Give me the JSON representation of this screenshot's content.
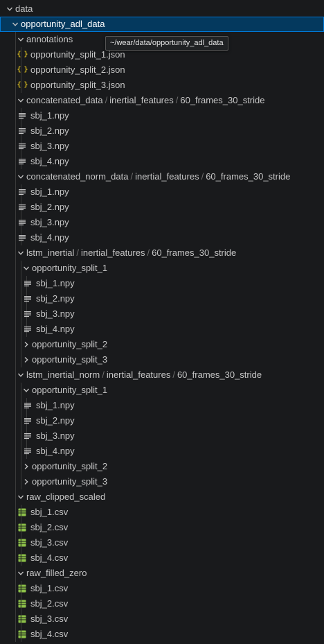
{
  "tooltip": "~/wear/data/opportunity_adl_data",
  "tree": [
    {
      "depth": 0,
      "type": "folder",
      "expanded": true,
      "label": "data"
    },
    {
      "depth": 1,
      "type": "folder",
      "expanded": true,
      "label": "opportunity_adl_data",
      "selected": true
    },
    {
      "depth": 2,
      "type": "folder",
      "expanded": true,
      "label": "annotations"
    },
    {
      "depth": 3,
      "type": "json",
      "label": "opportunity_split_1.json"
    },
    {
      "depth": 3,
      "type": "json",
      "label": "opportunity_split_2.json"
    },
    {
      "depth": 3,
      "type": "json",
      "label": "opportunity_split_3.json"
    },
    {
      "depth": 2,
      "type": "folder",
      "expanded": true,
      "label": [
        "concatenated_data",
        "inertial_features",
        "60_frames_30_stride"
      ]
    },
    {
      "depth": 3,
      "type": "npy",
      "label": "sbj_1.npy"
    },
    {
      "depth": 3,
      "type": "npy",
      "label": "sbj_2.npy"
    },
    {
      "depth": 3,
      "type": "npy",
      "label": "sbj_3.npy"
    },
    {
      "depth": 3,
      "type": "npy",
      "label": "sbj_4.npy"
    },
    {
      "depth": 2,
      "type": "folder",
      "expanded": true,
      "label": [
        "concatenated_norm_data",
        "inertial_features",
        "60_frames_30_stride"
      ]
    },
    {
      "depth": 3,
      "type": "npy",
      "label": "sbj_1.npy"
    },
    {
      "depth": 3,
      "type": "npy",
      "label": "sbj_2.npy"
    },
    {
      "depth": 3,
      "type": "npy",
      "label": "sbj_3.npy"
    },
    {
      "depth": 3,
      "type": "npy",
      "label": "sbj_4.npy"
    },
    {
      "depth": 2,
      "type": "folder",
      "expanded": true,
      "label": [
        "lstm_inertial",
        "inertial_features",
        "60_frames_30_stride"
      ]
    },
    {
      "depth": 3,
      "type": "folder",
      "expanded": true,
      "label": "opportunity_split_1"
    },
    {
      "depth": 4,
      "type": "npy",
      "label": "sbj_1.npy"
    },
    {
      "depth": 4,
      "type": "npy",
      "label": "sbj_2.npy"
    },
    {
      "depth": 4,
      "type": "npy",
      "label": "sbj_3.npy"
    },
    {
      "depth": 4,
      "type": "npy",
      "label": "sbj_4.npy"
    },
    {
      "depth": 3,
      "type": "folder",
      "expanded": false,
      "label": "opportunity_split_2"
    },
    {
      "depth": 3,
      "type": "folder",
      "expanded": false,
      "label": "opportunity_split_3"
    },
    {
      "depth": 2,
      "type": "folder",
      "expanded": true,
      "label": [
        "lstm_inertial_norm",
        "inertial_features",
        "60_frames_30_stride"
      ]
    },
    {
      "depth": 3,
      "type": "folder",
      "expanded": true,
      "label": "opportunity_split_1"
    },
    {
      "depth": 4,
      "type": "npy",
      "label": "sbj_1.npy"
    },
    {
      "depth": 4,
      "type": "npy",
      "label": "sbj_2.npy"
    },
    {
      "depth": 4,
      "type": "npy",
      "label": "sbj_3.npy"
    },
    {
      "depth": 4,
      "type": "npy",
      "label": "sbj_4.npy"
    },
    {
      "depth": 3,
      "type": "folder",
      "expanded": false,
      "label": "opportunity_split_2"
    },
    {
      "depth": 3,
      "type": "folder",
      "expanded": false,
      "label": "opportunity_split_3"
    },
    {
      "depth": 2,
      "type": "folder",
      "expanded": true,
      "label": "raw_clipped_scaled"
    },
    {
      "depth": 3,
      "type": "csv",
      "label": "sbj_1.csv"
    },
    {
      "depth": 3,
      "type": "csv",
      "label": "sbj_2.csv"
    },
    {
      "depth": 3,
      "type": "csv",
      "label": "sbj_3.csv"
    },
    {
      "depth": 3,
      "type": "csv",
      "label": "sbj_4.csv"
    },
    {
      "depth": 2,
      "type": "folder",
      "expanded": true,
      "label": "raw_filled_zero"
    },
    {
      "depth": 3,
      "type": "csv",
      "label": "sbj_1.csv"
    },
    {
      "depth": 3,
      "type": "csv",
      "label": "sbj_2.csv"
    },
    {
      "depth": 3,
      "type": "csv",
      "label": "sbj_3.csv"
    },
    {
      "depth": 3,
      "type": "csv",
      "label": "sbj_4.csv"
    }
  ],
  "colors": {
    "background": "#191a1c",
    "selection": "#04395e",
    "selection_border": "#0078d4",
    "json_icon": "#d7ba1f",
    "csv_icon": "#8dc149",
    "npy_icon": "#c5c5c5"
  },
  "icons": {
    "folder_open": "chevron-down-icon",
    "folder_closed": "chevron-right-icon",
    "json": "json-braces-icon",
    "npy": "text-lines-icon",
    "csv": "spreadsheet-icon"
  }
}
